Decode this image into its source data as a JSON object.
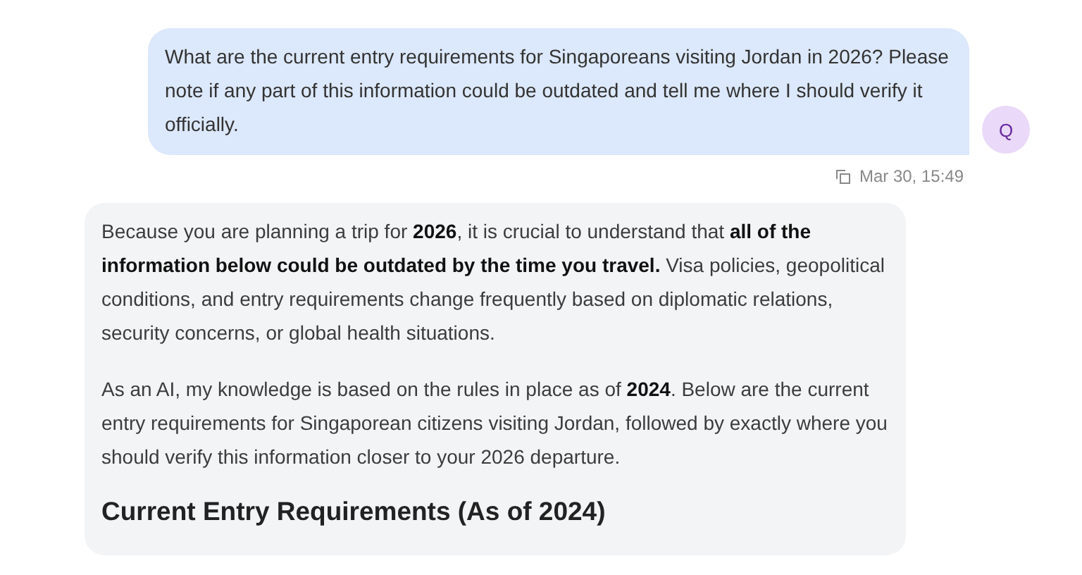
{
  "user_message": {
    "text": "What are the current entry requirements for Singaporeans visiting Jordan in 2026? Please note if any part of this information could be outdated and tell me where I should verify it officially.",
    "avatar_initial": "Q",
    "timestamp": "Mar 30, 15:49"
  },
  "assistant_message": {
    "paragraphs": [
      "Because you are planning a trip for **2026**, it is crucial to understand that **all of the information below could be outdated by the time you travel.** Visa policies, geopolitical conditions, and entry requirements change frequently based on diplomatic relations, security concerns, or global health situations.",
      "As an AI, my knowledge is based on the rules in place as of **2024**. Below are the current entry requirements for Singaporean citizens visiting Jordan, followed by exactly where you should verify this information closer to your 2026 departure."
    ],
    "heading": "Current Entry Requirements (As of 2024)"
  }
}
